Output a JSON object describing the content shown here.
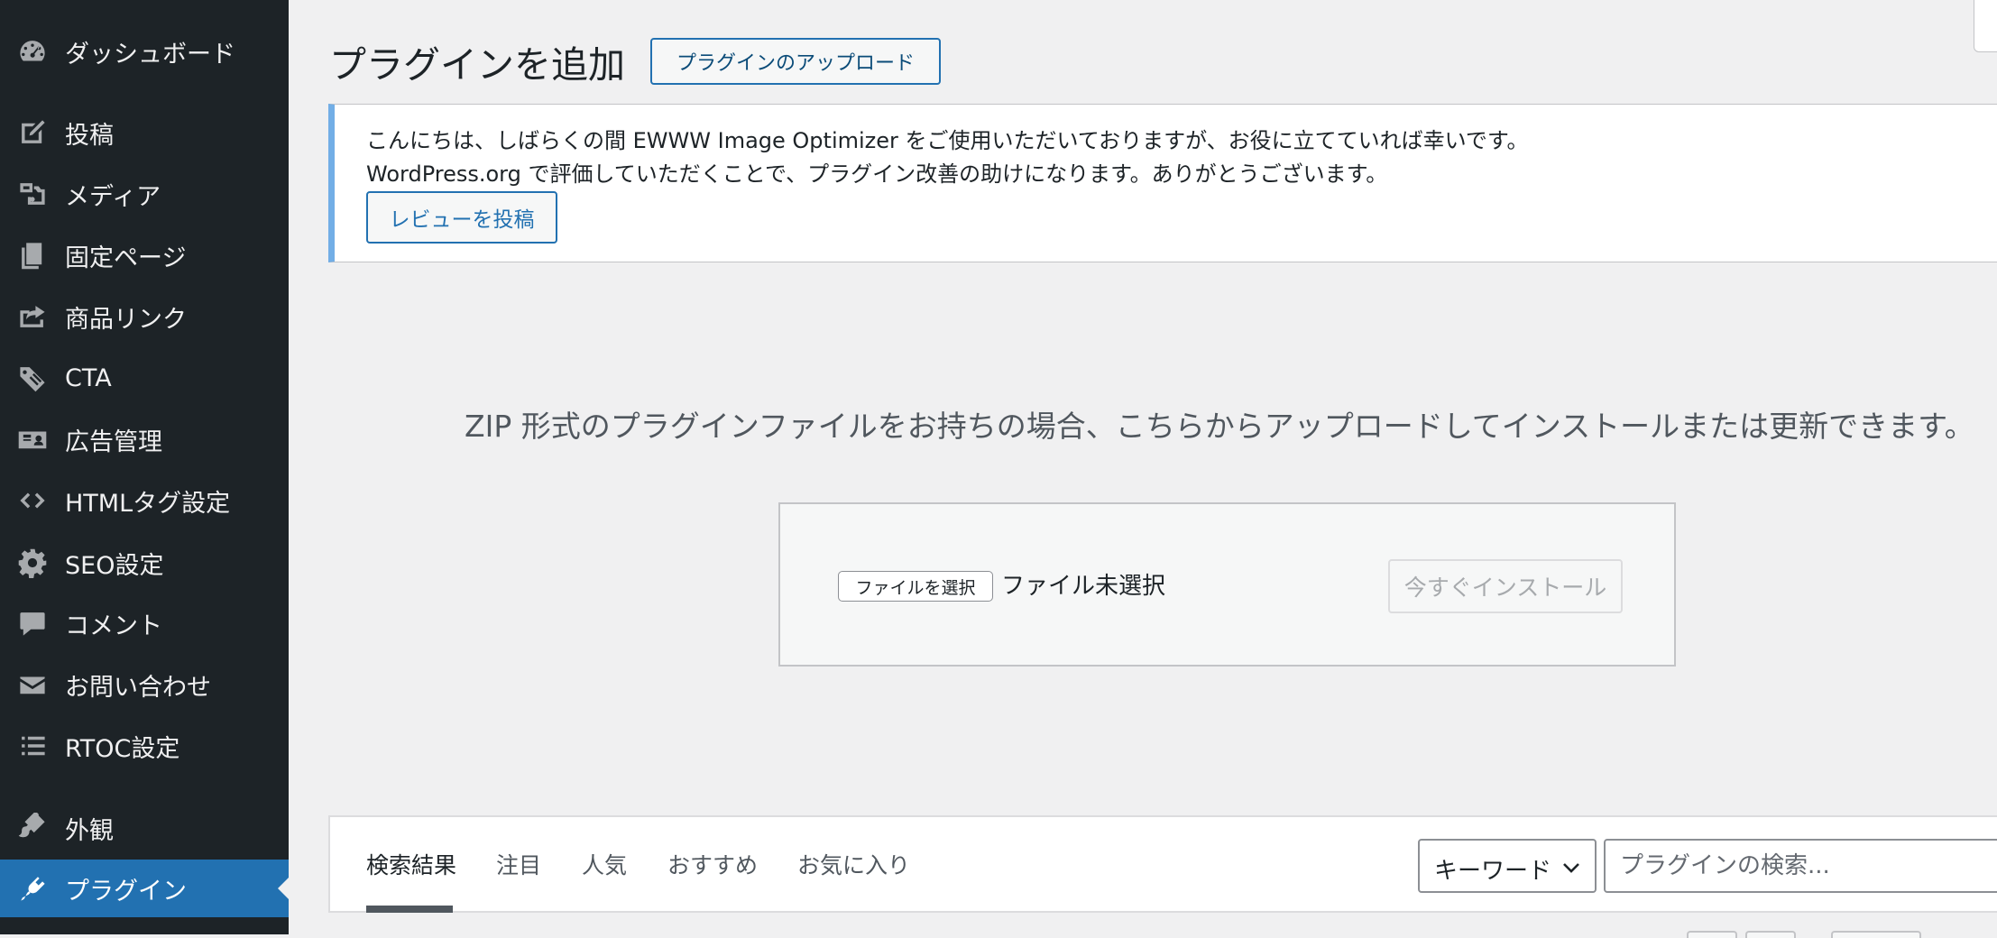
{
  "sidebar": {
    "items": [
      {
        "label": "ダッシュボード",
        "icon": "dashboard-icon"
      },
      {
        "label": "投稿",
        "icon": "post-icon"
      },
      {
        "label": "メディア",
        "icon": "media-icon"
      },
      {
        "label": "固定ページ",
        "icon": "page-icon"
      },
      {
        "label": "商品リンク",
        "icon": "share-icon"
      },
      {
        "label": "CTA",
        "icon": "tag-icon"
      },
      {
        "label": "広告管理",
        "icon": "id-card-icon"
      },
      {
        "label": "HTMLタグ設定",
        "icon": "code-icon"
      },
      {
        "label": "SEO設定",
        "icon": "gear-icon"
      },
      {
        "label": "コメント",
        "icon": "comment-icon"
      },
      {
        "label": "お問い合わせ",
        "icon": "mail-icon"
      },
      {
        "label": "RTOC設定",
        "icon": "list-icon"
      },
      {
        "label": "外観",
        "icon": "paintbrush-icon"
      },
      {
        "label": "プラグイン",
        "icon": "plugin-icon"
      }
    ],
    "active_item": "プラグイン"
  },
  "header": {
    "title": "プラグインを追加",
    "upload_button": "プラグインのアップロード"
  },
  "notice": {
    "line1": "こんにちは、しばらくの間 EWWW Image Optimizer をご使用いただいておりますが、お役に立てていれば幸いです。",
    "line2": "WordPress.org で評価していただくことで、プラグイン改善の助けになります。ありがとうございます。",
    "review_button": "レビューを投稿"
  },
  "upload": {
    "help_text": "ZIP 形式のプラグインファイルをお持ちの場合、こちらからアップロードしてインストールまたは更新できます。",
    "choose_file_button": "ファイルを選択",
    "file_status": "ファイル未選択",
    "install_button": "今すぐインストール"
  },
  "filter": {
    "tabs": [
      "検索結果",
      "注目",
      "人気",
      "おすすめ",
      "お気に入り"
    ],
    "active_tab": "検索結果",
    "search_type": "キーワード",
    "search_placeholder": "プラグインの検索..."
  },
  "colors": {
    "sidebar_bg": "#1d2327",
    "accent": "#2271b1",
    "notice_border": "#72aee6",
    "page_bg": "#f0f0f1"
  }
}
